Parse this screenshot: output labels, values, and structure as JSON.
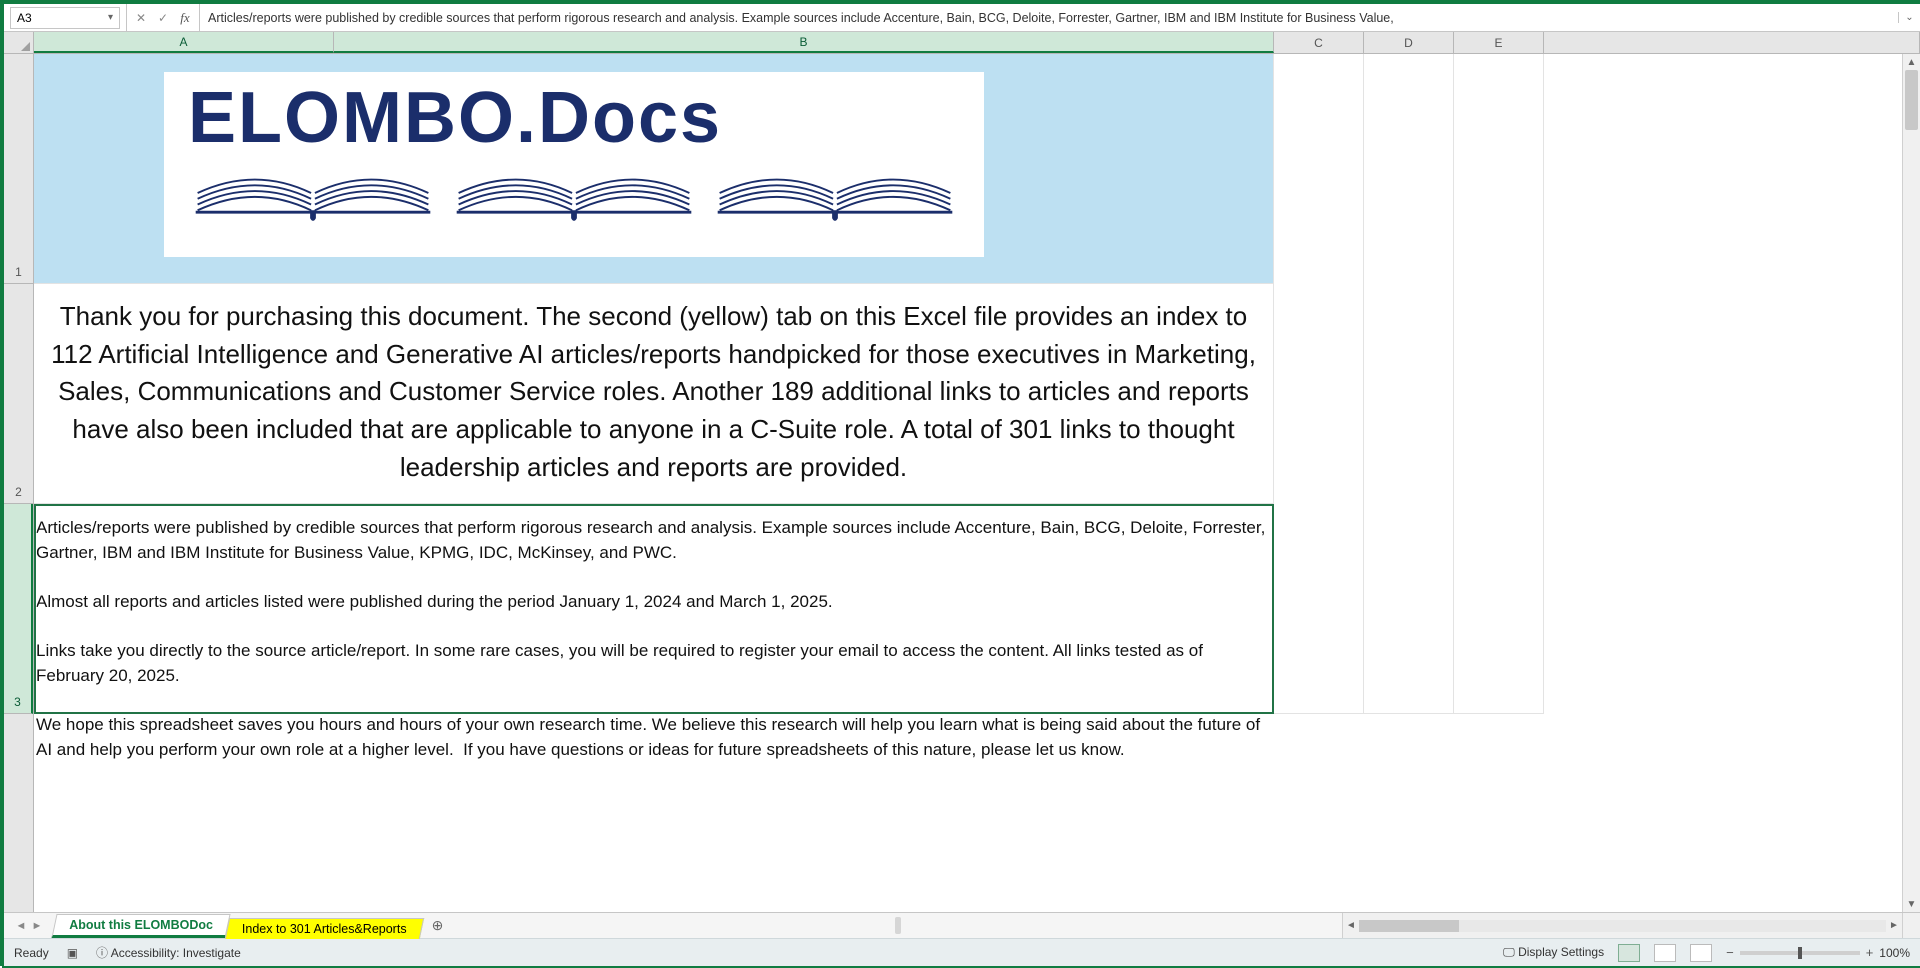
{
  "formula_bar": {
    "cell_ref": "A3",
    "formula_text": "Articles/reports were published by credible sources that perform rigorous research and analysis. Example sources include Accenture, Bain, BCG, Deloite, Forrester, Gartner, IBM and IBM Institute for Business Value,"
  },
  "columns": [
    "A",
    "B",
    "C",
    "D",
    "E"
  ],
  "rows": [
    "1",
    "2",
    "3"
  ],
  "logo": {
    "text": "ELOMBO.Docs"
  },
  "content": {
    "row2_intro": "Thank you for purchasing this document. The second (yellow) tab on this Excel file provides an index to 112 Artificial Intelligence and Generative AI articles/reports handpicked for those executives in Marketing, Sales, Communications and Customer Service roles. Another 189 additional links to articles and reports have also been included  that are applicable to anyone in a C-Suite role. A total of 301 links to thought leadership articles and reports are provided.",
    "row3_body": "Articles/reports were published by credible sources that perform rigorous research and analysis. Example sources include Accenture, Bain, BCG, Deloite, Forrester, Gartner, IBM and IBM Institute for Business Value, KPMG, IDC, McKinsey, and PWC.\n\nAlmost all reports and articles listed were published during the period January 1, 2024 and March 1, 2025.\n\nLinks take you directly to the source article/report. In some rare cases, you will be required to register your email to access the content. All links tested as of February 20, 2025.\n\nWe hope this spreadsheet saves you hours and hours of your own research time. We believe this research will help you learn what is being said about the future of AI and help you perform your own role at a higher level.  If you have questions or ideas for future spreadsheets of this nature, please let us know."
  },
  "tabs": {
    "active": "About this ELOMBODoc",
    "second": "Index to 301 Articles&Reports"
  },
  "status": {
    "ready": "Ready",
    "accessibility": "Accessibility: Investigate",
    "display_settings": "Display Settings",
    "zoom": "100%"
  },
  "selection": {
    "ref": "A3:B3"
  }
}
